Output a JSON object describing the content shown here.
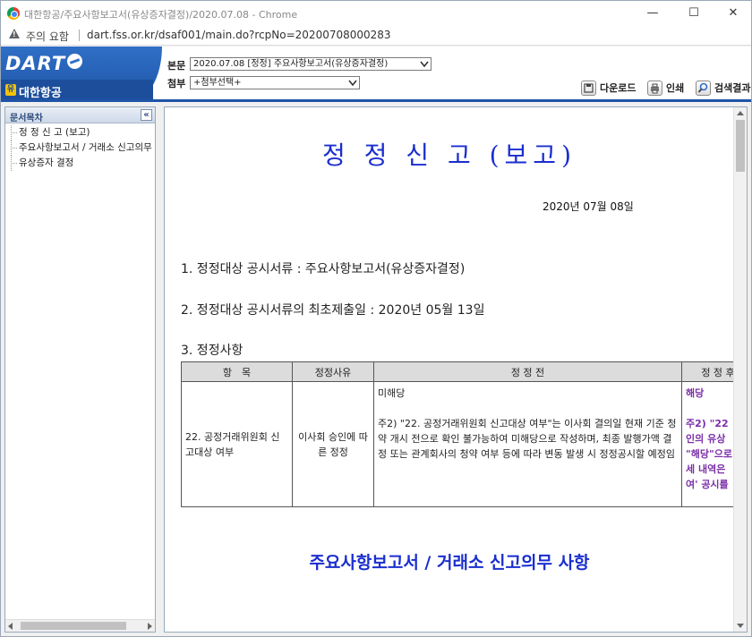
{
  "window": {
    "title": "대한항공/주요사항보고서(유상증자결정)/2020.07.08 - Chrome",
    "minimize": "—",
    "maximize": "☐",
    "close": "✕"
  },
  "address": {
    "warning": "주의 요함",
    "url": "dart.fss.or.kr/dsaf001/main.do?rcpNo=20200708000283"
  },
  "header": {
    "logo": "DART",
    "company": "대한항공",
    "company_icon": "유",
    "main_label": "본문",
    "main_select": "2020.07.08 [정정] 주요사항보고서(유상증자결정)",
    "attach_label": "첨부",
    "attach_select": "+첨부선택+",
    "download": "다운로드",
    "print": "인쇄",
    "search_result": "검색결과"
  },
  "sidebar": {
    "title": "문서목차",
    "collapse": "«",
    "items": [
      "정 정 신 고 (보고)",
      "주요사항보고서 / 거래소 신고의무",
      "유상증자 결정"
    ]
  },
  "document": {
    "title": "정 정 신 고 (보고)",
    "date": "2020년 07월 08일",
    "item1": "1. 정정대상 공시서류 : 주요사항보고서(유상증자결정)",
    "item2": "2. 정정대상 공시서류의 최초제출일 : 2020년 05월 13일",
    "item3": "3. 정정사항",
    "table": {
      "headers": [
        "항　목",
        "정정사유",
        "정 정 전",
        "정 정 후"
      ],
      "row": {
        "item": "22. 공정거래위원회 신고대상 여부",
        "reason": "이사회 승인에 따른 정정",
        "before_line1": "미해당",
        "before_line2": "주2) \"22. 공정거래위원회 신고대상 여부\"는 이사회 결의일 현재 기준 청약 개시 전으로 확인 불가능하여 미해당으로 작성하며, 최종 발행가액 결정 또는 관계회사의 청약 여부 등에 따라 변동 발생 시 정정공시할 예정임",
        "after_line1": "해당",
        "after_l2": "주2) \"22",
        "after_l3": "인의 유상",
        "after_l4": "\"해당\"으로",
        "after_l5": "세 내역은",
        "after_l6": "여' 공시를"
      }
    },
    "section2": "주요사항보고서 / 거래소 신고의무 사항"
  }
}
